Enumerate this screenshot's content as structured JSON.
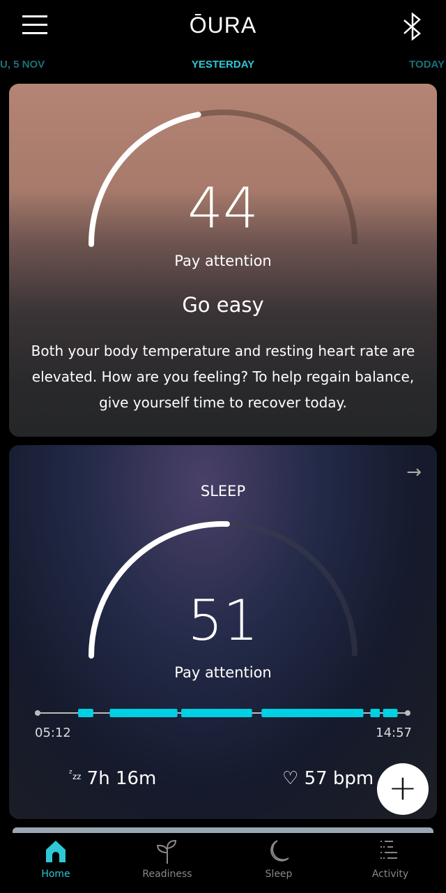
{
  "header": {
    "logo": "ŌURA",
    "menu_icon": "hamburger-icon",
    "bluetooth_icon": "bluetooth-icon"
  },
  "dates": {
    "previous": "U, 5 NOV",
    "current": "YESTERDAY",
    "next": "TODAY"
  },
  "readiness": {
    "score": 44,
    "status": "Pay attention",
    "headline": "Go easy",
    "description": "Both your body temperature and resting heart rate are elevated. How are you feeling? To help regain balance, give yourself time to recover today."
  },
  "sleep": {
    "title": "SLEEP",
    "score": 51,
    "status": "Pay attention",
    "start_time": "05:12",
    "end_time": "14:57",
    "segments": [
      [
        "06:16",
        "06:40"
      ],
      [
        "07:06",
        "08:53"
      ],
      [
        "08:59",
        "10:51"
      ],
      [
        "11:06",
        "13:47"
      ],
      [
        "13:58",
        "14:13"
      ],
      [
        "14:18",
        "14:41"
      ]
    ],
    "duration": "7h 16m",
    "heart_rate": "57 bpm"
  },
  "colors": {
    "accent": "#2ec7d8",
    "sleep_bar": "#00d0e4"
  },
  "fab": {
    "label": "+"
  },
  "nav": [
    {
      "label": "Home",
      "icon": "home-icon",
      "active": true
    },
    {
      "label": "Readiness",
      "icon": "sprout-icon"
    },
    {
      "label": "Sleep",
      "icon": "moon-icon"
    },
    {
      "label": "Activity",
      "icon": "activity-list-icon"
    }
  ]
}
